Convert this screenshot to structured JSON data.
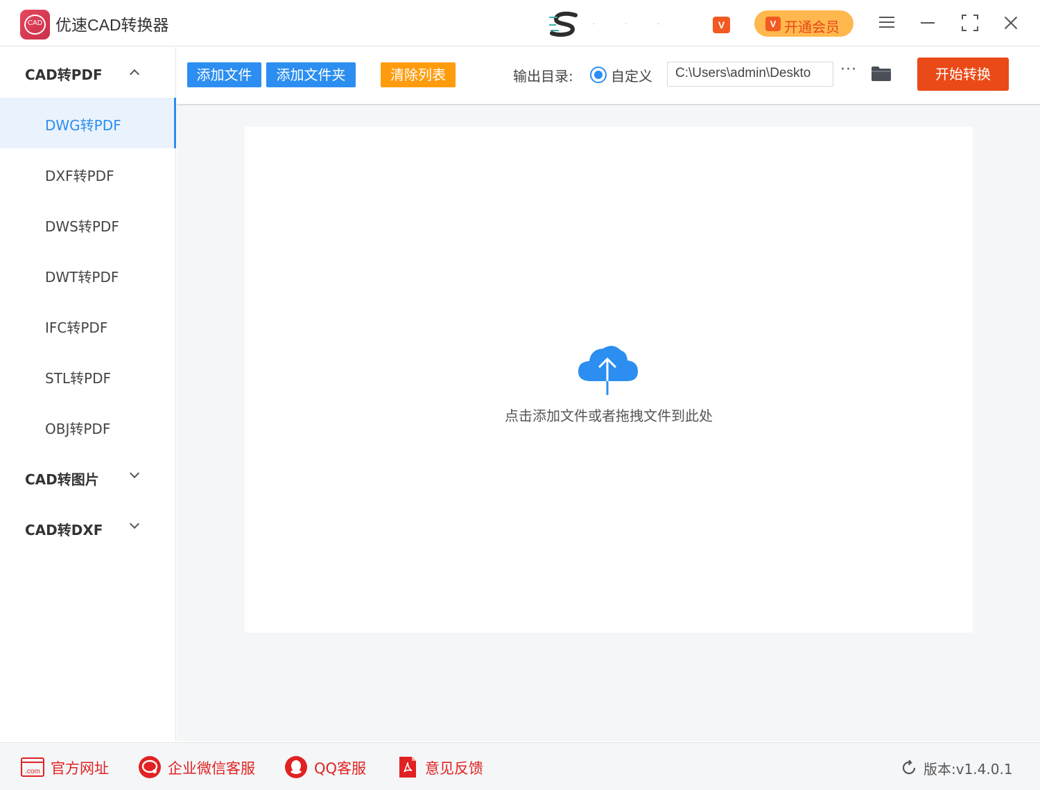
{
  "app": {
    "title": "优速CAD转换器",
    "logo_text": "CAD",
    "vip_small_text": "V",
    "vip_button_label": "开通会员",
    "vip_icon_text": "V"
  },
  "sidebar": {
    "groups": [
      {
        "label": "CAD转PDF",
        "expanded": true,
        "items": [
          {
            "label": "DWG转PDF",
            "active": true
          },
          {
            "label": "DXF转PDF"
          },
          {
            "label": "DWS转PDF"
          },
          {
            "label": "DWT转PDF"
          },
          {
            "label": "IFC转PDF"
          },
          {
            "label": "STL转PDF"
          },
          {
            "label": "OBJ转PDF"
          }
        ]
      },
      {
        "label": "CAD转图片",
        "expanded": false
      },
      {
        "label": "CAD转DXF",
        "expanded": false
      }
    ]
  },
  "toolbar": {
    "add_file": "添加文件",
    "add_folder": "添加文件夹",
    "clear_list": "清除列表",
    "output_dir_label": "输出目录:",
    "custom_option": "自定义",
    "output_path": "C:\\Users\\admin\\Deskto",
    "more_label": "···",
    "start_button": "开始转换"
  },
  "dropzone": {
    "hint": "点击添加文件或者拖拽文件到此处"
  },
  "footer": {
    "website": "官方网址",
    "website_icon_text": ".com",
    "wechat_service": "企业微信客服",
    "qq_service": "QQ客服",
    "feedback": "意见反馈",
    "version": "版本:v1.4.0.1"
  },
  "colors": {
    "accent_blue": "#2b8ef0",
    "add_buttons": "#2b8ef0",
    "clear_button": "#ff9c0e",
    "start_button": "#ea4a17",
    "vip_button_bg": "#ffb84d",
    "footer_red": "#e02222"
  }
}
